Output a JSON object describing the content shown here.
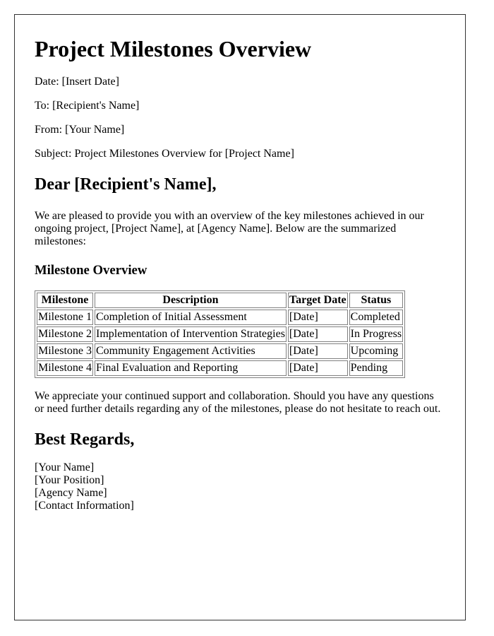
{
  "title": "Project Milestones Overview",
  "meta": {
    "date": "Date: [Insert Date]",
    "to": "To: [Recipient's Name]",
    "from": "From: [Your Name]",
    "subject": "Subject: Project Milestones Overview for [Project Name]"
  },
  "greeting": "Dear [Recipient's Name],",
  "intro": "We are pleased to provide you with an overview of the key milestones achieved in our ongoing project, [Project Name], at [Agency Name]. Below are the summarized milestones:",
  "section_title": "Milestone Overview",
  "table": {
    "headers": [
      "Milestone",
      "Description",
      "Target Date",
      "Status"
    ],
    "rows": [
      [
        "Milestone 1",
        "Completion of Initial Assessment",
        "[Date]",
        "Completed"
      ],
      [
        "Milestone 2",
        "Implementation of Intervention Strategies",
        "[Date]",
        "In Progress"
      ],
      [
        "Milestone 3",
        "Community Engagement Activities",
        "[Date]",
        "Upcoming"
      ],
      [
        "Milestone 4",
        "Final Evaluation and Reporting",
        "[Date]",
        "Pending"
      ]
    ]
  },
  "closing": "We appreciate your continued support and collaboration. Should you have any questions or need further details regarding any of the milestones, please do not hesitate to reach out.",
  "regards": "Best Regards,",
  "signature": [
    "[Your Name]",
    "[Your Position]",
    "[Agency Name]",
    "[Contact Information]"
  ]
}
